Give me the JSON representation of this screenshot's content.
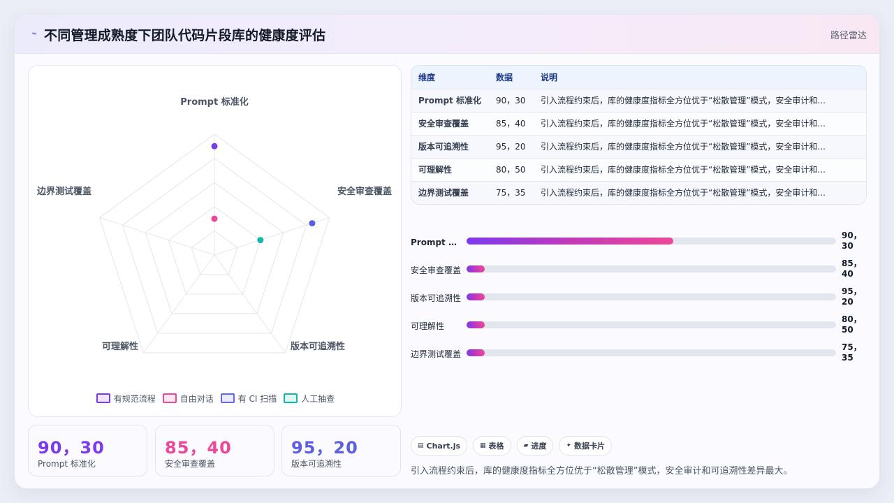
{
  "header": {
    "title": "不同管理成熟度下团队代码片段库的健康度评估",
    "icon": "pulse-icon",
    "right_label": "路径雷达"
  },
  "radar": {
    "axes": [
      "Prompt 标准化",
      "安全审查覆盖",
      "版本可追溯性",
      "可理解性",
      "边界测试覆盖"
    ],
    "points": [
      {
        "axis": "Prompt 标准化",
        "value": 90,
        "color": "#7c3aed"
      },
      {
        "axis": "Prompt 标准化",
        "value": 30,
        "color": "#ec4899"
      },
      {
        "axis": "安全审查覆盖",
        "value": 85,
        "color": "#5b5fe0"
      },
      {
        "axis": "安全审查覆盖",
        "value": 40,
        "color": "#14b8a6"
      }
    ]
  },
  "legend": [
    {
      "label": "有规范流程",
      "color": "#7c3aed"
    },
    {
      "label": "自由对话",
      "color": "#ec4899"
    },
    {
      "label": "有 CI 扫描",
      "color": "#6366f1"
    },
    {
      "label": "人工抽查",
      "color": "#14b8a6"
    }
  ],
  "kpis": [
    {
      "value": "90，30",
      "label": "Prompt 标准化",
      "color": "#7c3aed"
    },
    {
      "value": "85，40",
      "label": "安全审查覆盖",
      "color": "#ec4899"
    },
    {
      "value": "95，20",
      "label": "版本可追溯性",
      "color": "#5b5fe0"
    }
  ],
  "table": {
    "columns": [
      "维度",
      "数据",
      "说明"
    ],
    "rows": [
      {
        "dim": "Prompt 标准化",
        "data": "90，30",
        "note": "引入流程约束后，库的健康度指标全方位优于“松散管理”模式，安全审计和..."
      },
      {
        "dim": "安全审查覆盖",
        "data": "85，40",
        "note": "引入流程约束后，库的健康度指标全方位优于“松散管理”模式，安全审计和..."
      },
      {
        "dim": "版本可追溯性",
        "data": "95，20",
        "note": "引入流程约束后，库的健康度指标全方位优于“松散管理”模式，安全审计和..."
      },
      {
        "dim": "可理解性",
        "data": "80，50",
        "note": "引入流程约束后，库的健康度指标全方位优于“松散管理”模式，安全审计和..."
      },
      {
        "dim": "边界测试覆盖",
        "data": "75，35",
        "note": "引入流程约束后，库的健康度指标全方位优于“松散管理”模式，安全审计和..."
      }
    ]
  },
  "progress": [
    {
      "label": "Prompt 标...",
      "value": "90，30",
      "fill": 0.56
    },
    {
      "label": "安全审查覆盖",
      "value": "85，40",
      "fill": 0.05
    },
    {
      "label": "版本可追溯性",
      "value": "95，20",
      "fill": 0.05
    },
    {
      "label": "可理解性",
      "value": "80，50",
      "fill": 0.05
    },
    {
      "label": "边界测试覆盖",
      "value": "75，35",
      "fill": 0.05
    }
  ],
  "pills": [
    {
      "icon": "▤",
      "label": "Chart.js"
    },
    {
      "icon": "▦",
      "label": "表格"
    },
    {
      "icon": "▰",
      "label": "进度"
    },
    {
      "icon": "✦",
      "label": "数据卡片"
    }
  ],
  "summary": "引入流程约束后，库的健康度指标全方位优于“松散管理”模式，安全审计和可追溯性差异最大。"
}
